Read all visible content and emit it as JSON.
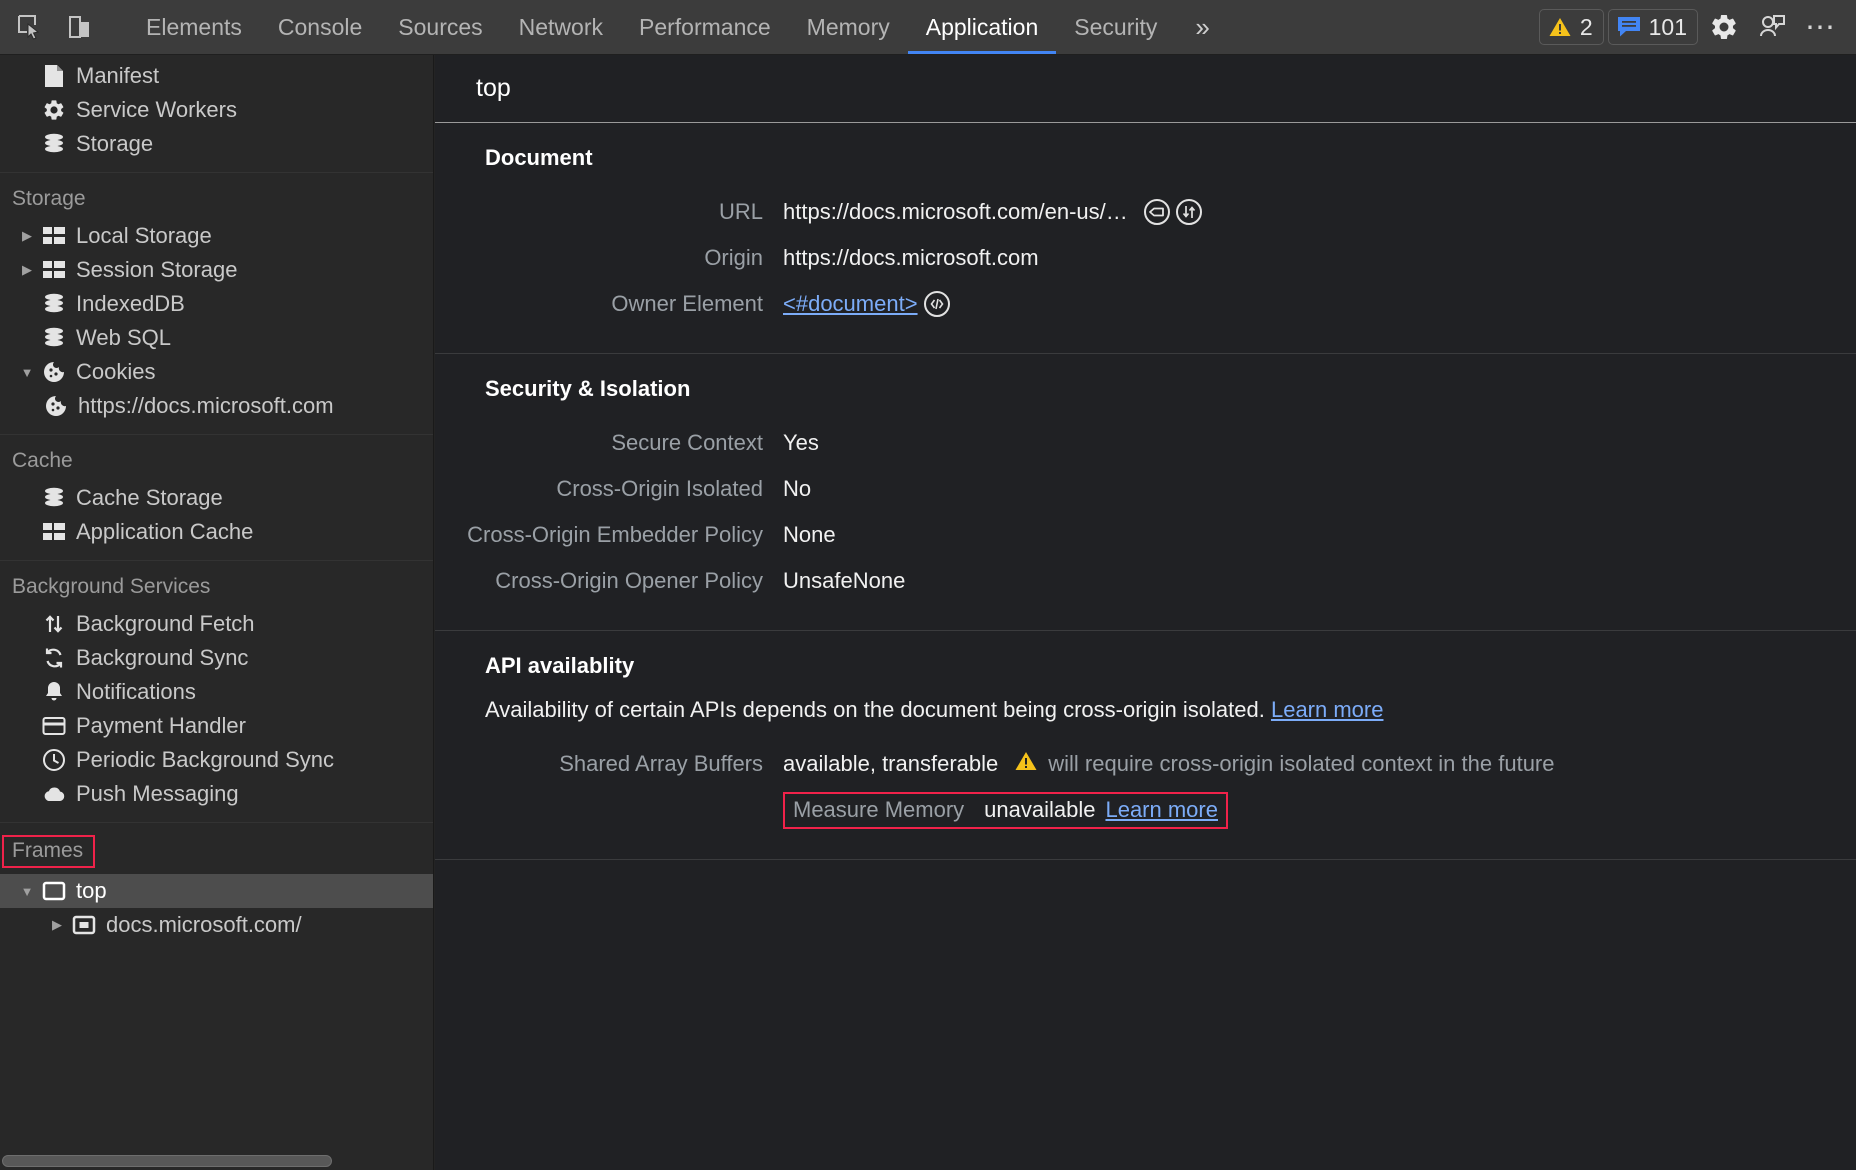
{
  "toolbar": {
    "left_icons": [
      {
        "name": "inspect-element-icon",
        "title": "Inspect element"
      },
      {
        "name": "device-toolbar-icon",
        "title": "Toggle device toolbar"
      }
    ],
    "tabs": [
      {
        "label": "Elements",
        "active": false
      },
      {
        "label": "Console",
        "active": false
      },
      {
        "label": "Sources",
        "active": false
      },
      {
        "label": "Network",
        "active": false
      },
      {
        "label": "Performance",
        "active": false
      },
      {
        "label": "Memory",
        "active": false
      },
      {
        "label": "Application",
        "active": true
      },
      {
        "label": "Security",
        "active": false
      }
    ],
    "more_tabs_glyph": "»",
    "warnings_count": "2",
    "messages_count": "101",
    "settings_icon": "gear-icon",
    "feedback_icon": "feedback-icon",
    "more_options_glyph": "⋯",
    "accent_color": "#4285f4",
    "warning_color": "#f5c21b",
    "message_color": "#4285f4"
  },
  "sidebar": {
    "top_items": [
      {
        "label": "Manifest",
        "icon": "manifest-document-icon",
        "indent": 1,
        "disclosure": ""
      },
      {
        "label": "Service Workers",
        "icon": "gear-icon",
        "indent": 1,
        "disclosure": ""
      },
      {
        "label": "Storage",
        "icon": "database-icon",
        "indent": 1,
        "disclosure": ""
      }
    ],
    "sections": [
      {
        "title": "Storage",
        "items": [
          {
            "label": "Local Storage",
            "icon": "table-icon",
            "indent": 1,
            "disclosure": "▶"
          },
          {
            "label": "Session Storage",
            "icon": "table-icon",
            "indent": 1,
            "disclosure": "▶"
          },
          {
            "label": "IndexedDB",
            "icon": "database-icon",
            "indent": 1,
            "disclosure": ""
          },
          {
            "label": "Web SQL",
            "icon": "database-icon",
            "indent": 1,
            "disclosure": ""
          },
          {
            "label": "Cookies",
            "icon": "cookie-icon",
            "indent": 1,
            "disclosure": "▼"
          },
          {
            "label": "https://docs.microsoft.com",
            "icon": "cookie-icon",
            "indent": 2,
            "disclosure": ""
          }
        ]
      },
      {
        "title": "Cache",
        "items": [
          {
            "label": "Cache Storage",
            "icon": "database-icon",
            "indent": 1,
            "disclosure": ""
          },
          {
            "label": "Application Cache",
            "icon": "table-icon",
            "indent": 1,
            "disclosure": ""
          }
        ]
      },
      {
        "title": "Background Services",
        "items": [
          {
            "label": "Background Fetch",
            "icon": "arrows-up-down-icon",
            "indent": 1,
            "disclosure": ""
          },
          {
            "label": "Background Sync",
            "icon": "sync-icon",
            "indent": 1,
            "disclosure": ""
          },
          {
            "label": "Notifications",
            "icon": "bell-icon",
            "indent": 1,
            "disclosure": ""
          },
          {
            "label": "Payment Handler",
            "icon": "credit-card-icon",
            "indent": 1,
            "disclosure": ""
          },
          {
            "label": "Periodic Background Sync",
            "icon": "clock-icon",
            "indent": 1,
            "disclosure": ""
          },
          {
            "label": "Push Messaging",
            "icon": "cloud-icon",
            "indent": 1,
            "disclosure": ""
          }
        ]
      }
    ],
    "frames": {
      "title": "Frames",
      "title_highlighted": true,
      "highlight_color": "#f0224a",
      "items": [
        {
          "label": "top",
          "icon": "frame-icon",
          "indent": 1,
          "disclosure": "▼",
          "selected": true
        },
        {
          "label": "docs.microsoft.com/",
          "icon": "subframe-icon",
          "indent": 3,
          "disclosure": "▶",
          "selected": false
        }
      ]
    }
  },
  "main": {
    "header_title": "top",
    "document_section": {
      "title": "Document",
      "rows": [
        {
          "key": "URL",
          "value": "https://docs.microsoft.com/en-us/…",
          "icons": [
            "tag-circle-icon",
            "arrow-up-down-circle-icon"
          ],
          "link": false
        },
        {
          "key": "Origin",
          "value": "https://docs.microsoft.com",
          "icons": [],
          "link": false
        },
        {
          "key": "Owner Element",
          "value": "<#document>",
          "icons": [
            "code-circle-icon"
          ],
          "link": true
        }
      ]
    },
    "security_section": {
      "title": "Security & Isolation",
      "rows": [
        {
          "key": "Secure Context",
          "value": "Yes"
        },
        {
          "key": "Cross-Origin Isolated",
          "value": "No"
        },
        {
          "key": "Cross-Origin Embedder Policy",
          "value": "None"
        },
        {
          "key": "Cross-Origin Opener Policy",
          "value": "UnsafeNone"
        }
      ]
    },
    "api_section": {
      "title": "API availablity",
      "description": "Availability of certain APIs depends on the document being cross-origin isolated.",
      "description_link": "Learn more",
      "shared_array_buffers": {
        "key": "Shared Array Buffers",
        "value": "available, transferable",
        "warning_icon": "warning-triangle-icon",
        "note": "will require cross-origin isolated context in the future"
      },
      "measure_memory": {
        "key": "Measure Memory",
        "value": "unavailable",
        "link": "Learn more",
        "highlighted": true,
        "highlight_color": "#f0224a"
      }
    }
  }
}
